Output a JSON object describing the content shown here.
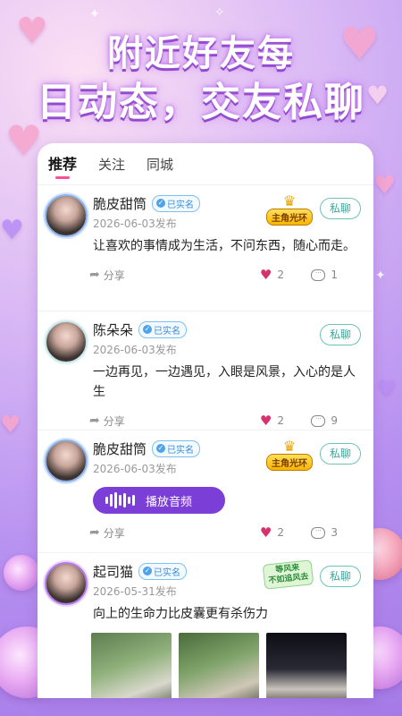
{
  "promo": {
    "line1": "附近好友每",
    "line2": "日动态，交友私聊"
  },
  "tabs": [
    {
      "label": "推荐",
      "active": true
    },
    {
      "label": "关注",
      "active": false
    },
    {
      "label": "同城",
      "active": false
    }
  ],
  "posts": [
    {
      "name": "脆皮甜筒",
      "badge": "已实名",
      "vip_label": "主角光环",
      "chat_label": "私聊",
      "date": "2026-06-03发布",
      "content": "让喜欢的事情成为生活，不问东西，随心而走。",
      "share_label": "分享",
      "likes": "2",
      "comments": "1"
    },
    {
      "name": "陈朵朵",
      "badge": "已实名",
      "chat_label": "私聊",
      "date": "2026-06-03发布",
      "content": "一边再见，一边遇见，入眼是风景，入心的是人生",
      "share_label": "分享",
      "likes": "2",
      "comments": "9"
    },
    {
      "name": "脆皮甜筒",
      "badge": "已实名",
      "vip_label": "主角光环",
      "chat_label": "私聊",
      "date": "2026-06-03发布",
      "audio_label": "播放音频",
      "share_label": "分享",
      "likes": "2",
      "comments": "3"
    },
    {
      "name": "起司猫",
      "badge": "已实名",
      "tag_line1": "等风来",
      "tag_line2": "不如追风去",
      "chat_label": "私聊",
      "date": "2026-05-31发布",
      "content": "向上的生命力比皮囊更有杀伤力"
    }
  ],
  "icons": {
    "share": "share-icon",
    "like": "heart-icon",
    "comment": "comment-icon",
    "verified": "verified-icon",
    "audio": "audio-wave-icon"
  },
  "colors": {
    "accent": "#7b3fd8",
    "tab_indicator": "#ff4d9a",
    "chat_button": "#3fa596",
    "like": "#d6336c",
    "background": "#b58ef0"
  }
}
